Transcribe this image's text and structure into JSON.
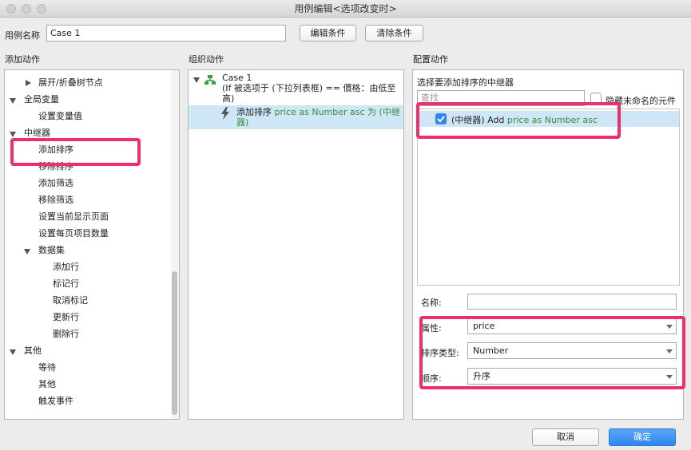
{
  "window": {
    "title": "用例编辑<选项改变时>"
  },
  "header": {
    "case_name_label": "用例名称",
    "case_name_value": "Case 1",
    "edit_condition_label": "编辑条件",
    "clear_condition_label": "清除条件"
  },
  "add_actions": {
    "title": "添加动作",
    "items": [
      {
        "label": "展开/折叠树节点"
      },
      {
        "label": "全局变量"
      },
      {
        "label": "设置变量值"
      },
      {
        "label": "中继器"
      },
      {
        "label": "添加排序"
      },
      {
        "label": "移除排序"
      },
      {
        "label": "添加筛选"
      },
      {
        "label": "移除筛选"
      },
      {
        "label": "设置当前显示页面"
      },
      {
        "label": "设置每页项目数量"
      },
      {
        "label": "数据集"
      },
      {
        "label": "添加行"
      },
      {
        "label": "标记行"
      },
      {
        "label": "取消标记"
      },
      {
        "label": "更新行"
      },
      {
        "label": "删除行"
      },
      {
        "label": "其他"
      },
      {
        "label": "等待"
      },
      {
        "label": "其他"
      },
      {
        "label": "触发事件"
      }
    ]
  },
  "organize_actions": {
    "title": "组织动作",
    "case_label": "Case 1",
    "condition_line1": "(If 被选项于 (下拉列表框) == 價格：由低至",
    "condition_line2": "高)",
    "action_prefix": "添加排序 ",
    "action_detail_line1": "price as Number asc 为 (中继",
    "action_detail_line2": "器)"
  },
  "configure_actions": {
    "title": "配置动作",
    "select_repeater_label": "选择要添加排序的中继器",
    "search_placeholder": "查找",
    "hide_unnamed_label": "隐藏未命名的元件",
    "repeater_item_prefix": "(中继器) Add ",
    "repeater_item_detail": "price as Number asc",
    "repeater_item_checked": true,
    "name_label": "名称:",
    "name_value": "",
    "property_label": "属性:",
    "property_value": "price",
    "sort_type_label": "排序类型:",
    "sort_type_value": "Number",
    "order_label": "顺序:",
    "order_value": "升序"
  },
  "footer": {
    "cancel_label": "取消",
    "ok_label": "确定"
  },
  "colors": {
    "highlight": "#ee2f6d",
    "selection": "#cfe6f6",
    "action_detail": "#3c8a3c",
    "primary_button": "#2e86ef"
  }
}
